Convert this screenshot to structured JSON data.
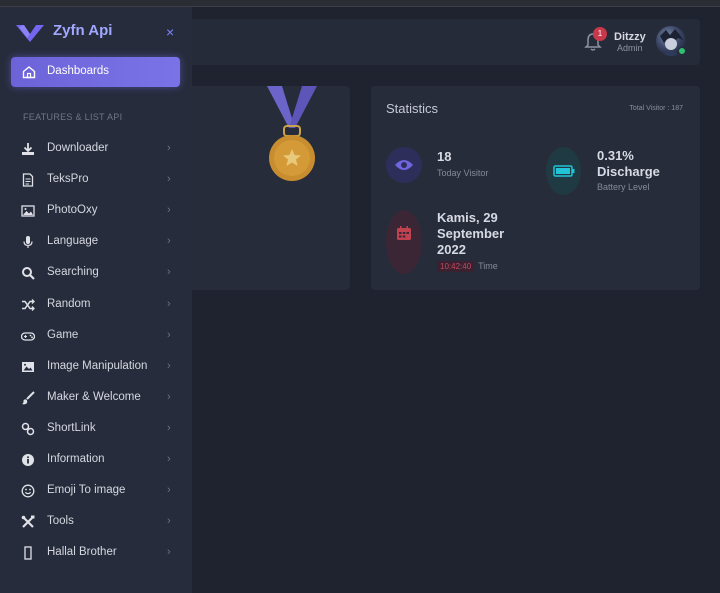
{
  "brand": {
    "name": "Zyfn Api",
    "close": "×"
  },
  "sidebar": {
    "active": {
      "label": "Dashboards",
      "icon": "home-icon"
    },
    "section_title": "FEATURES & LIST API",
    "items": [
      {
        "label": "Downloader",
        "icon": "download-icon"
      },
      {
        "label": "TeksPro",
        "icon": "document-icon"
      },
      {
        "label": "PhotoOxy",
        "icon": "image-icon"
      },
      {
        "label": "Language",
        "icon": "microphone-icon"
      },
      {
        "label": "Searching",
        "icon": "search-icon"
      },
      {
        "label": "Random",
        "icon": "shuffle-icon"
      },
      {
        "label": "Game",
        "icon": "gamepad-icon"
      },
      {
        "label": "Image Manipulation",
        "icon": "picture-icon"
      },
      {
        "label": "Maker & Welcome",
        "icon": "brush-icon"
      },
      {
        "label": "ShortLink",
        "icon": "link-icon"
      },
      {
        "label": "Information",
        "icon": "info-icon"
      },
      {
        "label": "Emoji To image",
        "icon": "smile-icon"
      },
      {
        "label": "Tools",
        "icon": "tools-icon"
      },
      {
        "label": "Hallal Brother",
        "icon": "bracket-icon"
      }
    ],
    "chevron": "›"
  },
  "navbar": {
    "notification_count": "1",
    "user_name": "Ditzzy",
    "user_role": "Admin"
  },
  "stats": {
    "title": "Statistics",
    "total_visitor": "Total Visitor : 187",
    "visitor": {
      "value": "18",
      "label": "Today Visitor"
    },
    "battery": {
      "value_line1": "0.31%",
      "value_line2": "Discharge",
      "label": "Battery Level"
    },
    "date": {
      "line1": "Kamis, 29",
      "line2": "September",
      "line3": "2022",
      "time": "10:42:40",
      "time_label": "Time"
    }
  },
  "colors": {
    "accent": "#7367f0",
    "sidebar_bg": "#272c3c",
    "body_bg": "#1f2330"
  }
}
